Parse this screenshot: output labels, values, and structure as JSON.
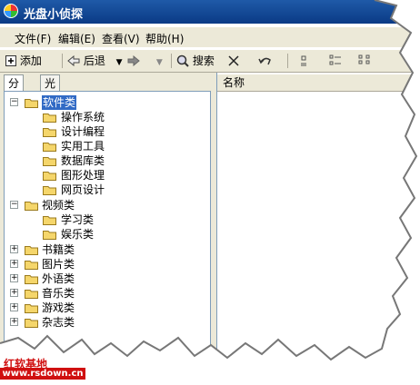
{
  "window": {
    "title": "光盘小侦探"
  },
  "menu": [
    "文件(F)",
    "编辑(E)",
    "查看(V)",
    "帮助(H)"
  ],
  "toolbar": {
    "add_label": "添加",
    "back_label": "后退",
    "search_label": "搜索"
  },
  "tabs": [
    "分类",
    "光盘"
  ],
  "list": {
    "column_name": "名称"
  },
  "tree": {
    "software": {
      "label": "软件类",
      "children": [
        "操作系统",
        "设计编程",
        "实用工具",
        "数据库类",
        "图形处理",
        "网页设计"
      ]
    },
    "video": {
      "label": "视频类",
      "children": [
        "学习类",
        "娱乐类"
      ]
    },
    "books": "书籍类",
    "pictures": "图片类",
    "languages": "外语类",
    "music": "音乐类",
    "games": "游戏类",
    "magazines": "杂志类"
  },
  "watermark": {
    "name": "红软基地",
    "url": "www.rsdown.cn"
  },
  "colors": {
    "titlebar": "#0a3a85",
    "selection": "#316ac5",
    "watermark": "#d01010"
  }
}
